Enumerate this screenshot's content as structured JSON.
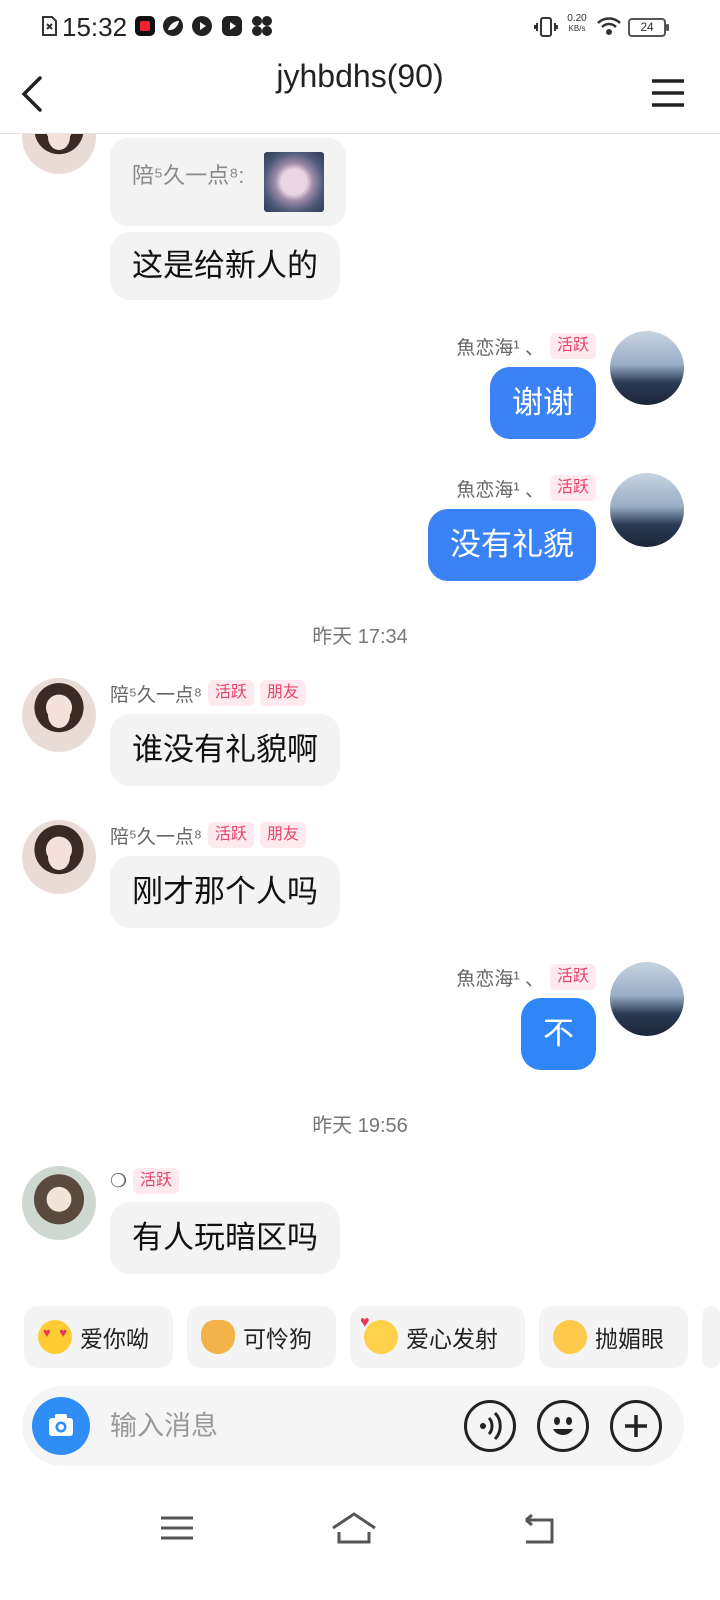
{
  "status_bar": {
    "time": "15:32",
    "net_speed_value": "0.20",
    "net_speed_unit": "KB/s",
    "battery": "24"
  },
  "header": {
    "title": "jyhbdhs(90)"
  },
  "messages": [
    {
      "reply_text": "陪⁵久一点⁸:",
      "text": "这是给新人的"
    },
    {
      "name": "魚恋海¹ 、",
      "tag": "活跃",
      "text": "谢谢"
    },
    {
      "name": "魚恋海¹ 、",
      "tag": "活跃",
      "text": "没有礼貌"
    },
    {
      "timestamp": "昨天 17:34"
    },
    {
      "name": "陪⁵久一点⁸",
      "tag": "活跃",
      "tag2": "朋友",
      "text": "谁没有礼貌啊"
    },
    {
      "name": "陪⁵久一点⁸",
      "tag": "活跃",
      "tag2": "朋友",
      "text": "刚才那个人吗"
    },
    {
      "name": "魚恋海¹ 、",
      "tag": "活跃",
      "text": "不"
    },
    {
      "timestamp": "昨天 19:56"
    },
    {
      "name": "❍",
      "tag": "活跃",
      "text": "有人玩暗区吗"
    }
  ],
  "quick_replies": [
    {
      "label": "爱你呦",
      "icon": "heart-eyes-emoji"
    },
    {
      "label": "可怜狗",
      "icon": "dog-emoji"
    },
    {
      "label": "爱心发射",
      "icon": "hearts-emoji"
    },
    {
      "label": "抛媚眼",
      "icon": "wink-emoji"
    }
  ],
  "input": {
    "placeholder": "输入消息"
  },
  "colors": {
    "accent": "#3b82f6",
    "tag_text": "#e8436a",
    "tag_bg": "#fde9ee"
  }
}
